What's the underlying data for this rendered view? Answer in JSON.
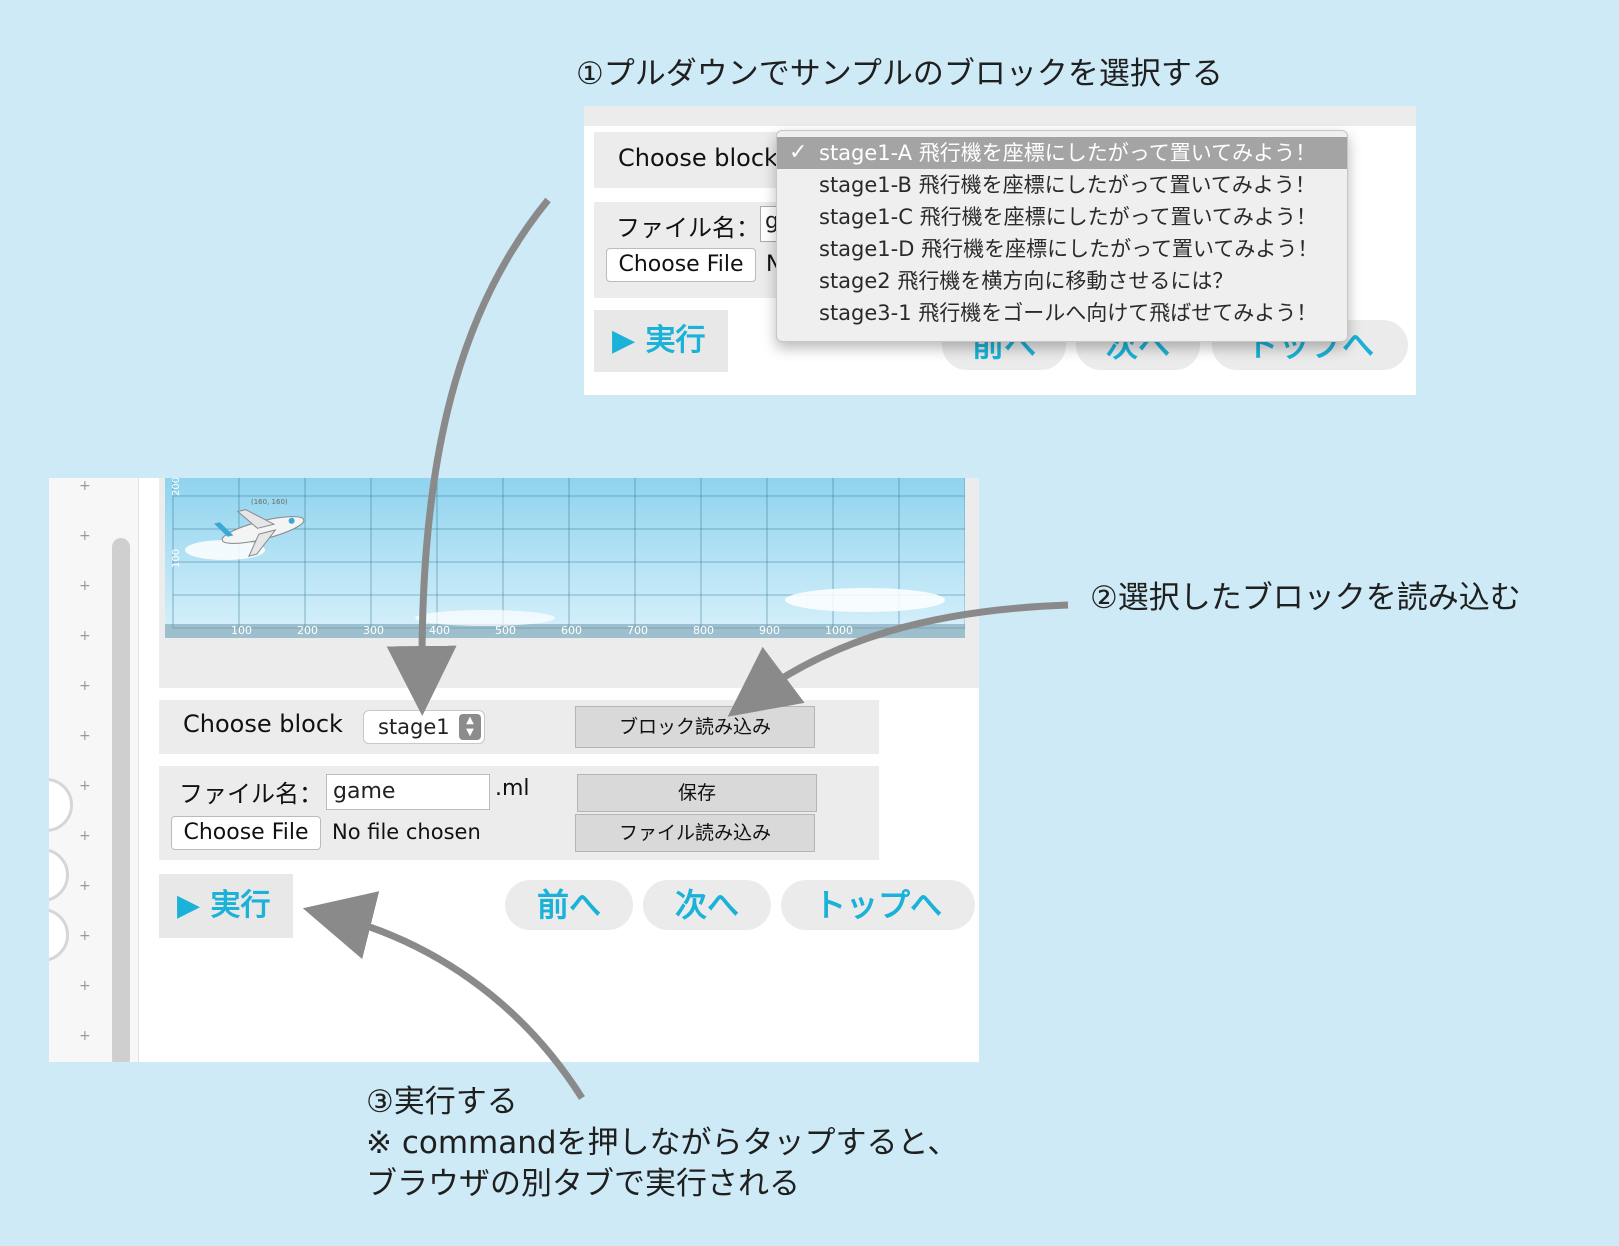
{
  "annotations": {
    "step1": "①プルダウンでサンプルのブロックを選択する",
    "step2": "②選択したブロックを読み込む",
    "step3_line1": "③実行する",
    "step3_line2": "※ commandを押しながらタップすると、",
    "step3_line3": "ブラウザの別タブで実行される"
  },
  "top_panel": {
    "choose_block_label": "Choose block",
    "file_name_label": "ファイル名：",
    "file_name_value": "g",
    "choose_file_button": "Choose File",
    "no_file_partial": "N",
    "run_button": "▶ 実行",
    "prev_button": "前へ",
    "next_button": "次へ",
    "top_button": "トップへ",
    "dropdown": {
      "selected_index": 0,
      "check_mark": "✓",
      "options": [
        "stage1-A 飛行機を座標にしたがって置いてみよう！",
        "stage1-B 飛行機を座標にしたがって置いてみよう！",
        "stage1-C 飛行機を座標にしたがって置いてみよう！",
        "stage1-D 飛行機を座標にしたがって置いてみよう！",
        "stage2 飛行機を横方向に移動させるには？",
        "stage3-1 飛行機をゴールへ向けて飛ばせてみよう！"
      ]
    }
  },
  "editor": {
    "stage": {
      "x_ticks": [
        "100",
        "200",
        "300",
        "400",
        "500",
        "600",
        "700",
        "800",
        "900",
        "1000"
      ],
      "y_ticks": [
        "100",
        "200"
      ],
      "plane_label": "(160, 160)",
      "colors": {
        "sky_top": "#8fd3ee",
        "sky_bottom": "#d8f1fb",
        "grid": "#2d6f8c"
      }
    },
    "choose_block_label": "Choose block",
    "select_value": "stage1",
    "load_block_button": "ブロック読み込み",
    "file_name_label": "ファイル名：",
    "file_name_value": "game",
    "file_ext": ".ml",
    "save_button": "保存",
    "load_file_button": "ファイル読み込み",
    "choose_file_button": "Choose File",
    "no_file_chosen": "No file chosen",
    "run_button": "▶ 実行",
    "prev_button": "前へ",
    "next_button": "次へ",
    "top_button": "トップへ"
  },
  "colors": {
    "background": "#cdeaf6",
    "accent": "#1ab2d8",
    "arrow": "#8a8a8a"
  }
}
